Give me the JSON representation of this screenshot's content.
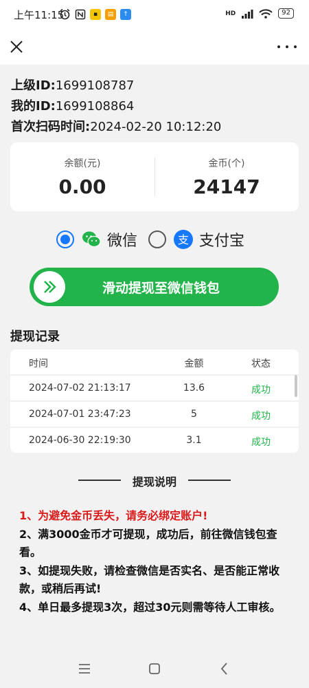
{
  "status_bar": {
    "time": "上午11:15",
    "network": "HD",
    "battery": "92",
    "icons": [
      "alarm-icon",
      "nfc-icon",
      "app-notification-icon",
      "message-icon",
      "upload-icon",
      "signal-icon",
      "wifi-icon",
      "battery-icon"
    ]
  },
  "top_bar": {
    "close_icon": "close-icon",
    "more_icon": "more-icon"
  },
  "info": {
    "parent_id_label": "上级ID:",
    "parent_id_value": "1699108787",
    "my_id_label": "我的ID:",
    "my_id_value": "1699108864",
    "first_scan_label": "首次扫码时间:",
    "first_scan_value": "2024-02-20 10:12:20"
  },
  "balance": {
    "balance_label": "余额(元)",
    "balance_value": "0.00",
    "coins_label": "金币(个)",
    "coins_value": "24147"
  },
  "payment": {
    "wechat_label": "微信",
    "alipay_label": "支付宝",
    "selected": "wechat"
  },
  "withdraw_button": {
    "label": "滑动提现至微信钱包"
  },
  "records": {
    "title": "提现记录",
    "headers": [
      "时间",
      "金额",
      "状态"
    ],
    "rows": [
      {
        "time": "2024-07-02 21:13:17",
        "amount": "13.6",
        "status": "成功"
      },
      {
        "time": "2024-07-01 23:47:23",
        "amount": "5",
        "status": "成功"
      },
      {
        "time": "2024-06-30 22:19:30",
        "amount": "3.1",
        "status": "成功"
      }
    ]
  },
  "explanation": {
    "title": "提现说明",
    "rules": [
      "1、为避免金币丢失，请务必绑定账户!",
      "2、满3000金币才可提现，成功后，前往微信钱包查看。",
      "3、如提现失败，请检查微信是否实名、是否能正常收款，或稍后再试!",
      "4、单日最多提现3次，超过30元则需等待人工审核。"
    ]
  },
  "colors": {
    "accent_green": "#22b44a",
    "accent_blue": "#1677ff",
    "warning_red": "#d91a1a"
  }
}
